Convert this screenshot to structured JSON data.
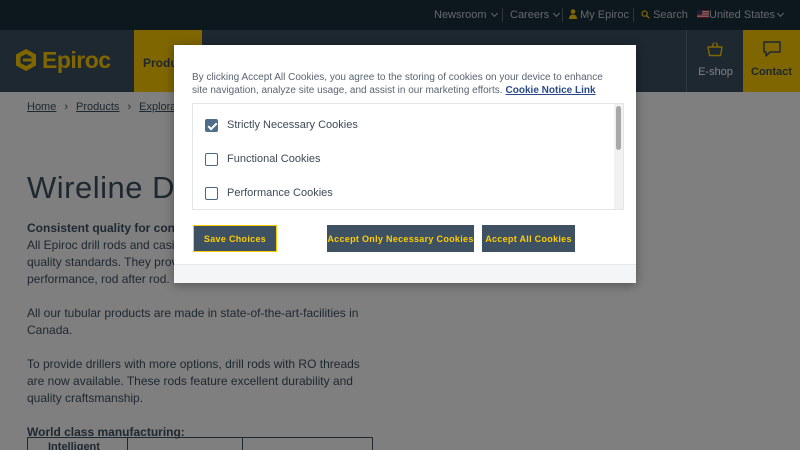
{
  "utility_bar": {
    "newsroom": "Newsroom",
    "careers": "Careers",
    "my_epiroc": "My Epiroc",
    "search": "Search",
    "region": "United States"
  },
  "header": {
    "logo_text": "Epiroc",
    "products_tab": "Produ",
    "eshop": "E-shop",
    "contact": "Contact"
  },
  "breadcrumb": [
    "Home",
    "Products",
    "Explorat"
  ],
  "page": {
    "title": "Wireline D",
    "intro_heading": "Consistent quality for consi",
    "intro_lines": [
      "All Epiroc drill rods and casi",
      "quality standards. They prov",
      "performance, rod after rod."
    ],
    "p2_lines": [
      "All our tubular products are made in state-of-the-art-facilities in",
      "Canada."
    ],
    "p3_lines": [
      "To provide drillers with more options, drill rods with RO threads",
      "are now available. These rods feature excellent durability and",
      "quality craftsmanship."
    ],
    "manufacturing_heading": "World class manufacturing:",
    "table_header": "Intelligent"
  },
  "cookie_modal": {
    "notice": "By clicking Accept All Cookies, you agree to the storing of cookies on your device to enhance site navigation, analyze site usage, and assist in our marketing efforts.",
    "notice_link": "Cookie Notice Link",
    "categories": [
      {
        "label": "Strictly Necessary Cookies",
        "checked": true
      },
      {
        "label": "Functional Cookies",
        "checked": false
      },
      {
        "label": "Performance Cookies",
        "checked": false
      }
    ],
    "buttons": {
      "save": "Save Choices",
      "necessary": "Accept Only Necessary Cookies",
      "all": "Accept All Cookies"
    }
  },
  "colors": {
    "brand_yellow": "#ffcd00",
    "brand_navy": "#3d5163",
    "utility_bar": "#1b2e3c"
  }
}
